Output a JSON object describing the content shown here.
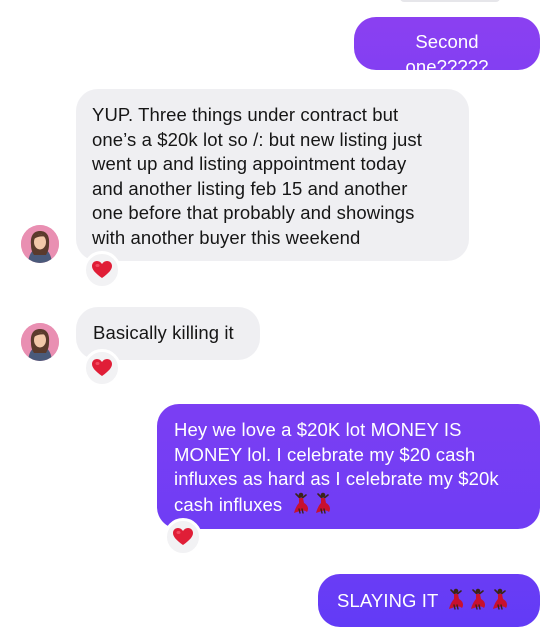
{
  "theme": {
    "incoming_bg": "#efeff2",
    "outgoing_gradient_top": "#8a3ff2",
    "outgoing_gradient_bottom": "#6a3cf5",
    "reaction_heart_color": "#e01e37",
    "avatar_bg": "#e98fb2"
  },
  "messages": [
    {
      "direction": "outgoing",
      "text": "Second one?????"
    },
    {
      "direction": "incoming",
      "lines": [
        "YUP. Three things under contract but",
        "one’s a $20k lot so /: but new listing just",
        "went up and listing appointment today",
        "and another listing feb 15 and another",
        "one before that probably and showings",
        "with another buyer this weekend"
      ],
      "reaction": "heart-icon"
    },
    {
      "direction": "incoming",
      "text": "Basically killing it",
      "reaction": "heart-icon"
    },
    {
      "direction": "outgoing",
      "lines": [
        "Hey we love a $20K lot MONEY IS",
        "MONEY lol. I celebrate my $20 cash",
        "influxes as hard as I celebrate my $20k",
        "cash influxes"
      ],
      "emoji": [
        "dancer-icon",
        "dancer-icon"
      ],
      "reaction": "heart-icon"
    },
    {
      "direction": "outgoing",
      "text": "SLAYING IT",
      "emoji": [
        "dancer-icon",
        "dancer-icon",
        "dancer-icon"
      ]
    }
  ]
}
